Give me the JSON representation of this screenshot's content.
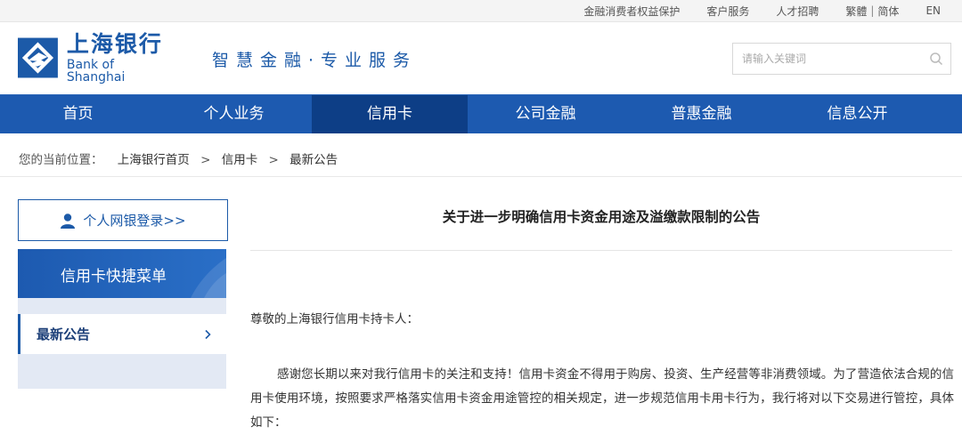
{
  "topbar": {
    "links": [
      "金融消费者权益保护",
      "客户服务",
      "人才招聘"
    ],
    "lang_trad": "繁體",
    "lang_sep": "|",
    "lang_simp": "简体",
    "lang_en": "EN"
  },
  "header": {
    "logo_cn": "上海银行",
    "logo_en": "Bank of Shanghai",
    "slogan": "智慧金融·专业服务",
    "search_placeholder": "请输入关键词",
    "brand_color": "#1c5aa8"
  },
  "nav": {
    "items": [
      "首页",
      "个人业务",
      "信用卡",
      "公司金融",
      "普惠金融",
      "信息公开"
    ],
    "active_index": 2,
    "bg_color": "#1d5ab0",
    "active_color": "#0d3e86"
  },
  "breadcrumb": {
    "label": "您的当前位置：",
    "crumbs": [
      "上海银行首页",
      "信用卡",
      "最新公告"
    ],
    "separator": ">"
  },
  "sidebar": {
    "login_label": "个人网银登录>>",
    "quick_menu_title": "信用卡快捷菜单",
    "menu_items": [
      "最新公告"
    ]
  },
  "article": {
    "title": "关于进一步明确信用卡资金用途及溢缴款限制的公告",
    "salutation": "尊敬的上海银行信用卡持卡人：",
    "paragraph1": "感谢您长期以来对我行信用卡的关注和支持！信用卡资金不得用于购房、投资、生产经营等非消费领域。为了营造依法合规的信用卡使用环境，按照要求严格落实信用卡资金用途管控的相关规定，进一步规范信用卡用卡行为，我行将对以下交易进行管控，具体如下："
  }
}
